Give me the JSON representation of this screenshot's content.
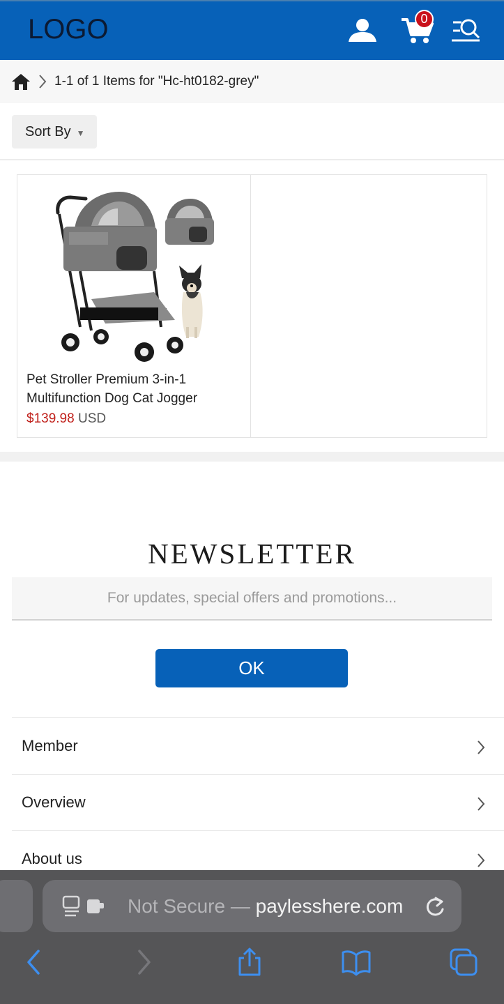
{
  "colors": {
    "brand_blue": "#0761b8",
    "price_red": "#c0201b",
    "badge_red": "#c9101a"
  },
  "header": {
    "logo": "LOGO",
    "cart_count": "0",
    "icons": [
      "user-icon",
      "cart-icon",
      "menu-search-icon"
    ]
  },
  "breadcrumb": {
    "text": "1-1 of 1 Items for \"Hc-ht0182-grey\""
  },
  "sort": {
    "label": "Sort By"
  },
  "products": [
    {
      "title": "Pet Stroller Premium 3-in-1 Multifunction Dog Cat Jogger",
      "price": "$139.98",
      "currency": "USD"
    }
  ],
  "newsletter": {
    "title": "NEWSLETTER",
    "placeholder": "For updates, special offers and promotions...",
    "button": "OK"
  },
  "footer_links": [
    "Member",
    "Overview",
    "About us"
  ],
  "browser": {
    "address_prefix": "Not Secure — ",
    "address_domain": "paylesshere.com"
  }
}
